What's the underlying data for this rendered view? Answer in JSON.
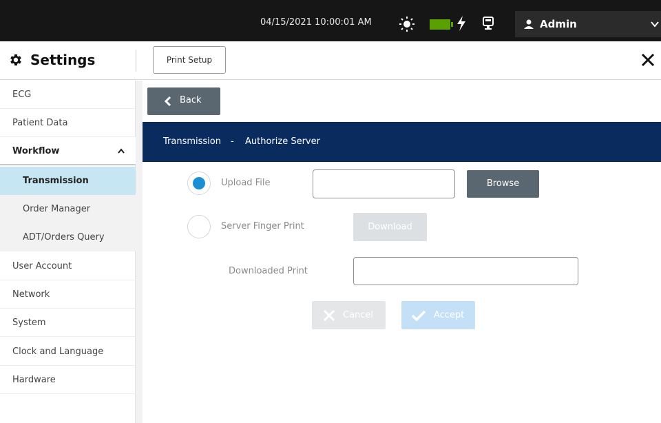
{
  "status_bar": {
    "datetime": "04/15/2021 10:00:01 AM",
    "icons": [
      "sun-icon",
      "battery-icon",
      "charging-bolt-icon",
      "monitor-icon"
    ],
    "battery_color": "#5aa000",
    "user": {
      "name": "Admin",
      "icon": "user-icon"
    }
  },
  "header": {
    "title": "Settings",
    "print_setup_label": "Print Setup"
  },
  "sidebar": {
    "items": [
      {
        "label": "ECG"
      },
      {
        "label": "Patient Data"
      },
      {
        "label": "Workflow",
        "expanded": true
      },
      {
        "label": "Transmission",
        "sub": true,
        "active": true
      },
      {
        "label": "Order Manager",
        "sub": true
      },
      {
        "label": "ADT/Orders Query",
        "sub": true
      },
      {
        "label": "User Account"
      },
      {
        "label": "Network"
      },
      {
        "label": "System"
      },
      {
        "label": "Clock and Language"
      },
      {
        "label": "Hardware"
      }
    ],
    "active_color": "#c7e6f3"
  },
  "main": {
    "back_label": "Back",
    "banner": {
      "section": "Transmission",
      "separator": "-",
      "page": "Authorize Server",
      "color": "#0a2b5e"
    },
    "upload_file_label": "Upload File",
    "upload_file_value": "",
    "browse_label": "Browse",
    "server_fp_label": "Server Finger Print",
    "download_label": "Download",
    "downloaded_print_label": "Downloaded Print",
    "downloaded_print_value": "",
    "cancel_label": "Cancel",
    "accept_label": "Accept",
    "selected_option": "Upload File",
    "accent_color": "#1a8fd6"
  }
}
